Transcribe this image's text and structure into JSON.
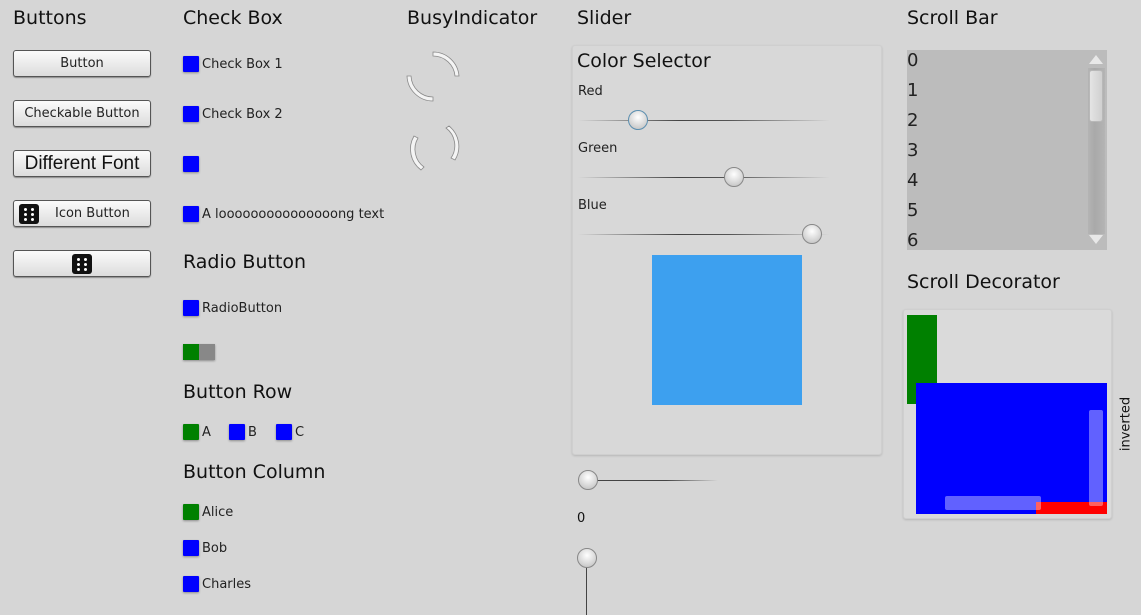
{
  "sections": {
    "buttons": "Buttons",
    "check_box": "Check Box",
    "busy_indicator": "BusyIndicator",
    "slider": "Slider",
    "scroll_bar": "Scroll Bar",
    "radio_button": "Radio Button",
    "button_row": "Button Row",
    "button_column": "Button Column",
    "scroll_decorator": "Scroll Decorator"
  },
  "buttons": {
    "button": "Button",
    "checkable": "Checkable Button",
    "different_font": "Different Font",
    "icon_button": "Icon Button",
    "icon_name": "dice-icon"
  },
  "checkboxes": [
    {
      "label": "Check Box 1",
      "checked": false
    },
    {
      "label": "Check Box 2",
      "checked": false
    },
    {
      "label": "",
      "checked": false
    },
    {
      "label": "A looooooooooooooong text",
      "checked": false
    }
  ],
  "radio": {
    "label": "RadioButton",
    "checked": false
  },
  "switch": {
    "on": true
  },
  "button_row": [
    {
      "label": "A",
      "checked": true
    },
    {
      "label": "B",
      "checked": false
    },
    {
      "label": "C",
      "checked": false
    }
  ],
  "button_column": [
    {
      "label": "Alice",
      "checked": true
    },
    {
      "label": "Bob",
      "checked": false
    },
    {
      "label": "Charles",
      "checked": false
    }
  ],
  "color_selector": {
    "title": "Color Selector",
    "red_label": "Red",
    "green_label": "Green",
    "blue_label": "Blue",
    "red": 0.24,
    "green": 0.62,
    "blue": 0.93,
    "preview_color": "#3da0ef"
  },
  "slider": {
    "horizontal_value": 0,
    "value_label": "0",
    "vertical_value": 0
  },
  "scroll_bar": {
    "items": [
      "0",
      "1",
      "2",
      "3",
      "4",
      "5",
      "6"
    ],
    "position": 0
  },
  "scroll_decorator": {
    "inverted_label": "inverted",
    "colors": {
      "green": "#008000",
      "blue": "#0000ff",
      "red": "#ff0000"
    }
  },
  "colors": {
    "checked": "#008000",
    "unchecked": "#0000ff",
    "background": "#d6d6d6"
  }
}
